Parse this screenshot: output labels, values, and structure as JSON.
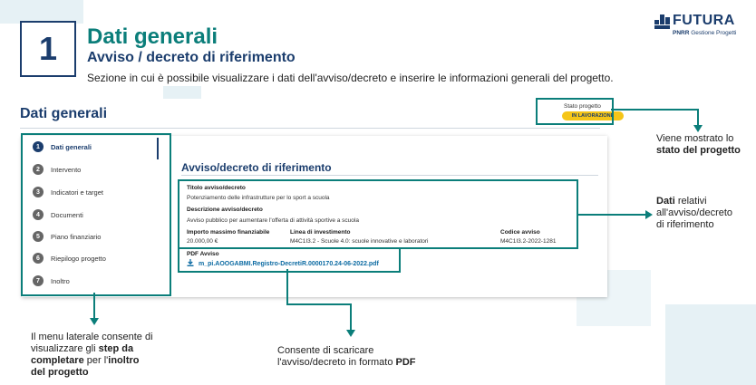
{
  "slide": {
    "step_number": "1",
    "title": "Dati generali",
    "subtitle": "Avviso / decreto di riferimento",
    "description": "Sezione in cui è possibile visualizzare i dati dell'avviso/decreto e inserire le informazioni generali del progetto."
  },
  "logo": {
    "name": "FUTURA",
    "sub_brand": "PNRR",
    "sub_text": "Gestione Progetti"
  },
  "screen": {
    "title": "Dati generali",
    "status_label": "Stato progetto",
    "status_value": "IN LAVORAZIONE",
    "menu": [
      {
        "num": "1",
        "label": "Dati generali"
      },
      {
        "num": "2",
        "label": "Intervento"
      },
      {
        "num": "3",
        "label": "Indicatori e target"
      },
      {
        "num": "4",
        "label": "Documenti"
      },
      {
        "num": "5",
        "label": "Piano finanziario"
      },
      {
        "num": "6",
        "label": "Riepilogo progetto"
      },
      {
        "num": "7",
        "label": "Inoltro"
      }
    ],
    "section_title": "Avviso/decreto di riferimento",
    "fields": {
      "titolo_label": "Titolo avviso/decreto",
      "titolo_value": "Potenziamento delle infrastrutture per lo sport a scuola",
      "descrizione_label": "Descrizione avviso/decreto",
      "descrizione_value": "Avviso pubblico per aumentare l'offerta di attività sportive a scuola",
      "importo_label": "Importo massimo finanziabile",
      "importo_value": "20.000,00 €",
      "linea_label": "Linea di investimento",
      "linea_value": "M4C1I3.2 - Scuole 4.0: scuole innovative e laboratori",
      "codice_label": "Codice avviso",
      "codice_value": "M4C1I3.2-2022-1281",
      "pdf_label": "PDF Avviso",
      "pdf_file": "m_pi.AOOGABMI.Registro-DecretiR.0000170.24-06-2022.pdf"
    }
  },
  "annotations": {
    "status_note_1": "Viene mostrato lo",
    "status_note_2": "stato del progetto",
    "data_note_1": "Dati",
    "data_note_2": " relativi",
    "data_note_3": "all'avviso/decreto",
    "data_note_4": "di riferimento",
    "menu_note_1": "Il menu laterale consente di",
    "menu_note_2": "visualizzare gli ",
    "menu_note_3": "step da",
    "menu_note_4": "completare",
    "menu_note_5": " per l'",
    "menu_note_6": "inoltro",
    "menu_note_7": "del progetto",
    "pdf_note_1": "Consente di scaricare",
    "pdf_note_2": "l'avviso/decreto in formato ",
    "pdf_note_3": "PDF"
  },
  "colors": {
    "teal": "#0b7e7a",
    "navy": "#1b3d6d",
    "status_yellow": "#f5c518",
    "link": "#0b6aa2"
  }
}
